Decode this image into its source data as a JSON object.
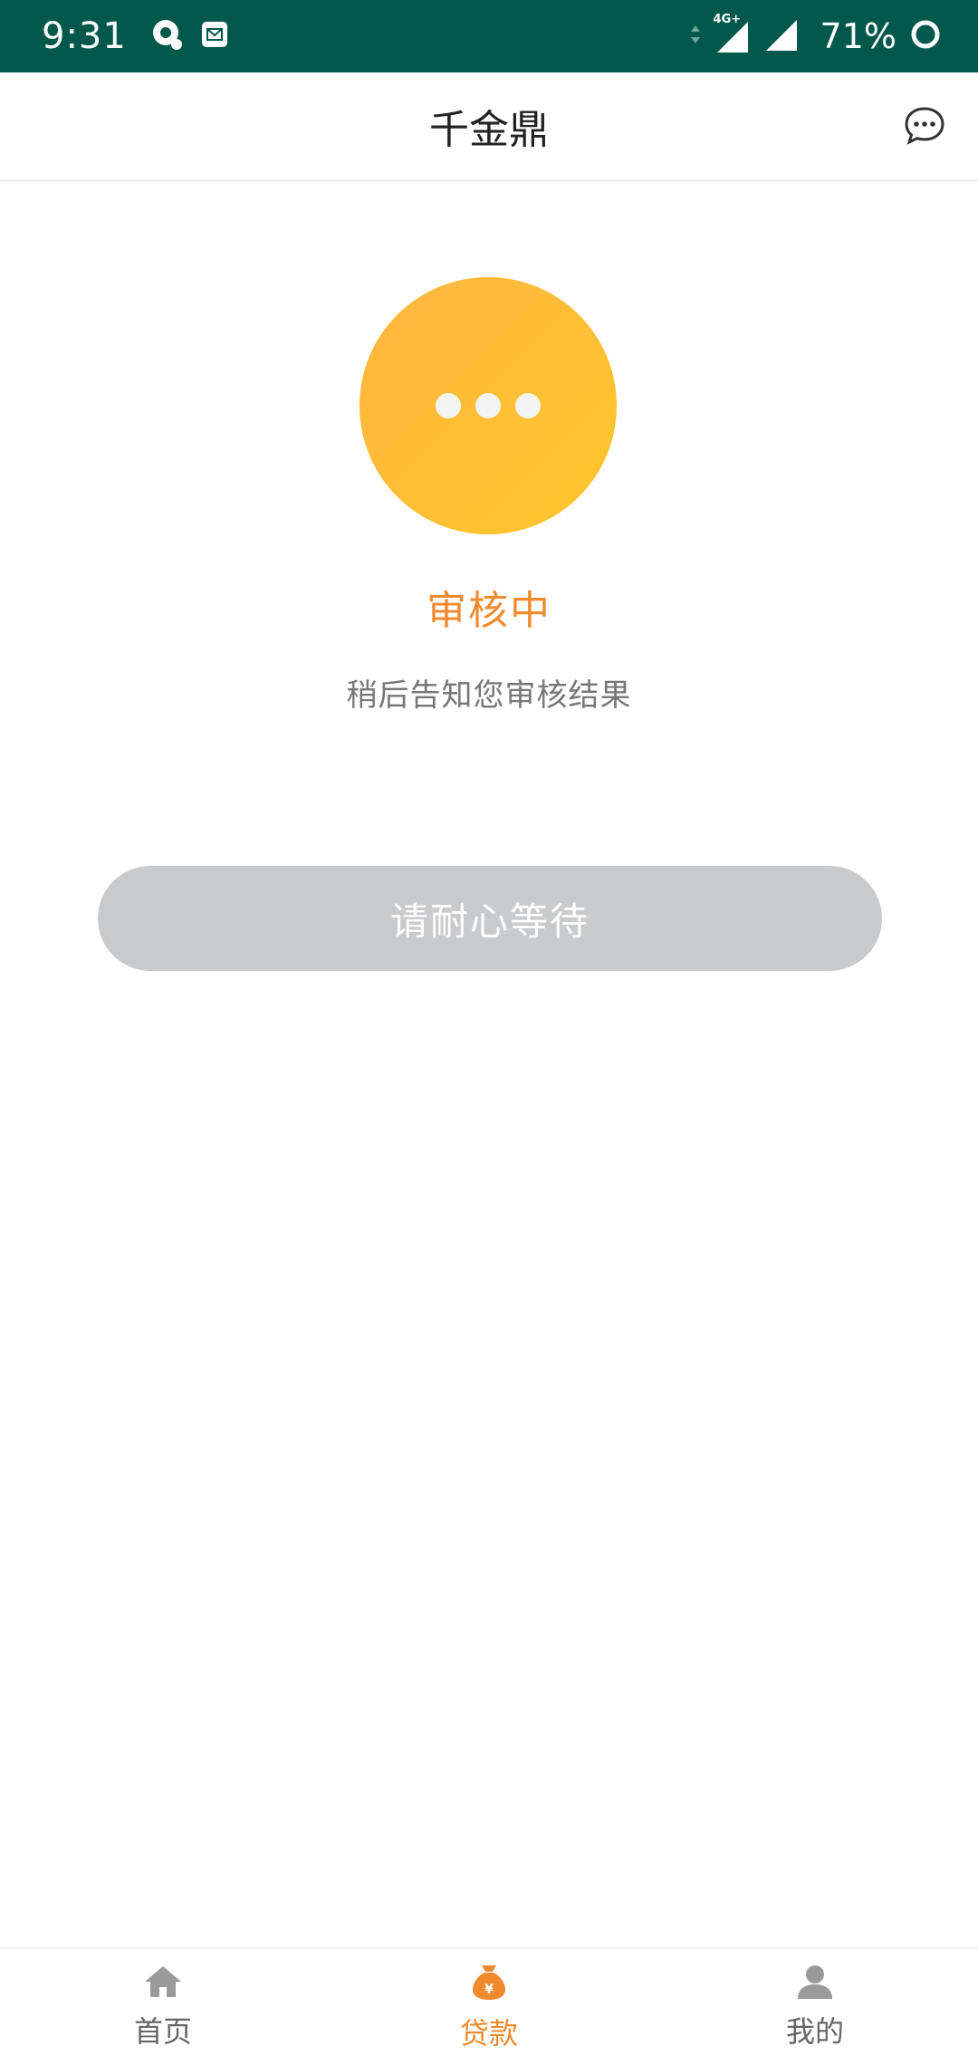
{
  "status_bar": {
    "time": "9:31",
    "network_label": "4G+",
    "battery": "71%"
  },
  "header": {
    "title": "千金鼎",
    "message_icon": "chat-bubble-icon"
  },
  "status": {
    "title": "审核中",
    "subtitle": "稍后告知您审核结果",
    "circle_icon": "ellipsis-icon",
    "colors": {
      "accent": "#f08a2c",
      "circle_start": "#ffb63f",
      "circle_end": "#ffc62c"
    }
  },
  "action": {
    "wait_label": "请耐心等待"
  },
  "bottom_nav": {
    "items": [
      {
        "label": "首页",
        "icon": "home-icon",
        "active": false
      },
      {
        "label": "贷款",
        "icon": "money-bag-icon",
        "active": true
      },
      {
        "label": "我的",
        "icon": "person-icon",
        "active": false
      }
    ]
  }
}
